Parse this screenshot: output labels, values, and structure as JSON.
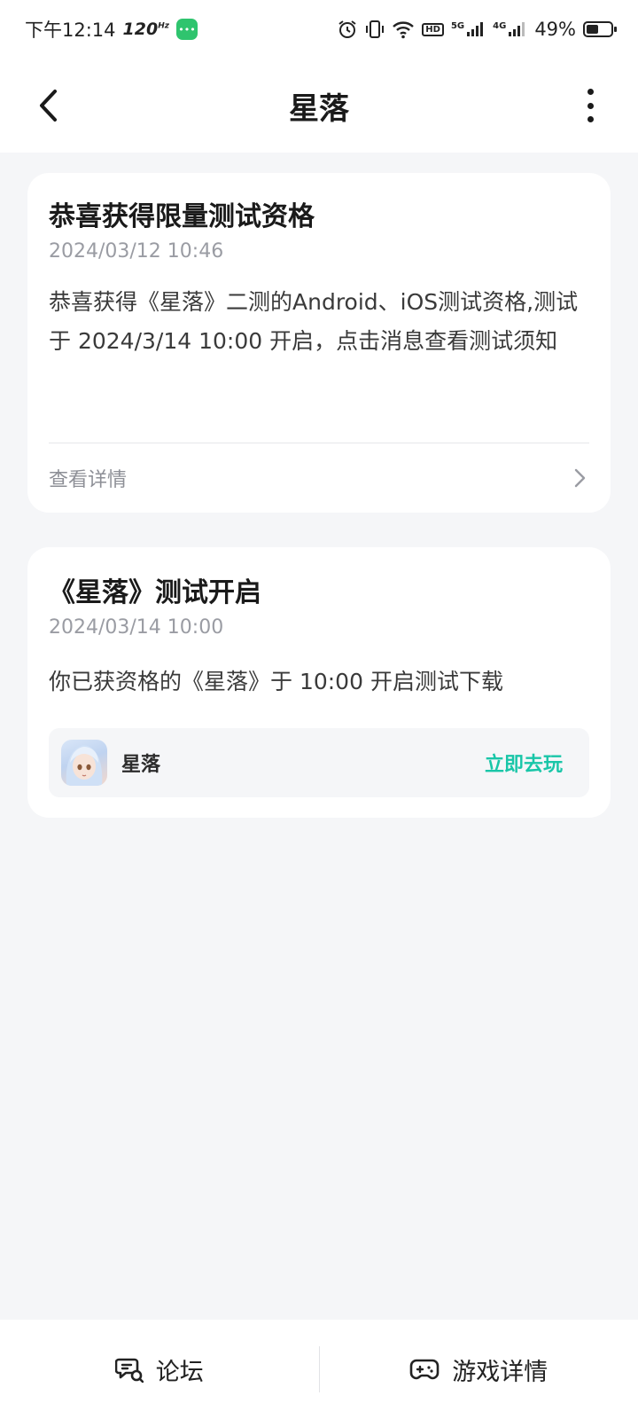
{
  "status_bar": {
    "time": "下午12:14",
    "refresh_rate": "120",
    "refresh_unit": "Hz",
    "network_5g": "5G",
    "network_4g": "4G",
    "hd_label": "HD",
    "battery_percent": "49%",
    "battery_level": 0.49,
    "icons": [
      "chat-app-icon",
      "alarm-icon",
      "vibrate-icon",
      "wifi-icon",
      "signal-icon",
      "battery-icon"
    ]
  },
  "header": {
    "title": "星落",
    "back_icon": "chevron-left-icon",
    "more_icon": "more-vertical-icon"
  },
  "messages": [
    {
      "title": "恭喜获得限量测试资格",
      "time": "2024/03/12 10:46",
      "body": "恭喜获得《星落》二测的Android、iOS测试资格,测试于 2024/3/14 10:00 开启，点击消息查看测试须知",
      "detail_label": "查看详情",
      "detail_icon": "chevron-right-icon"
    },
    {
      "title": "《星落》测试开启",
      "time": "2024/03/14 10:00",
      "body": "你已获资格的《星落》于 10:00 开启测试下载",
      "game_name": "星落",
      "play_label": "立即去玩",
      "game_icon": "game-avatar-icon"
    }
  ],
  "bottom_bar": {
    "forum_label": "论坛",
    "forum_icon": "forum-chat-icon",
    "details_label": "游戏详情",
    "details_icon": "gamepad-icon"
  },
  "colors": {
    "accent": "#19c6a8",
    "background": "#f5f6f8",
    "card": "#ffffff",
    "muted_text": "#9a9ca3"
  }
}
